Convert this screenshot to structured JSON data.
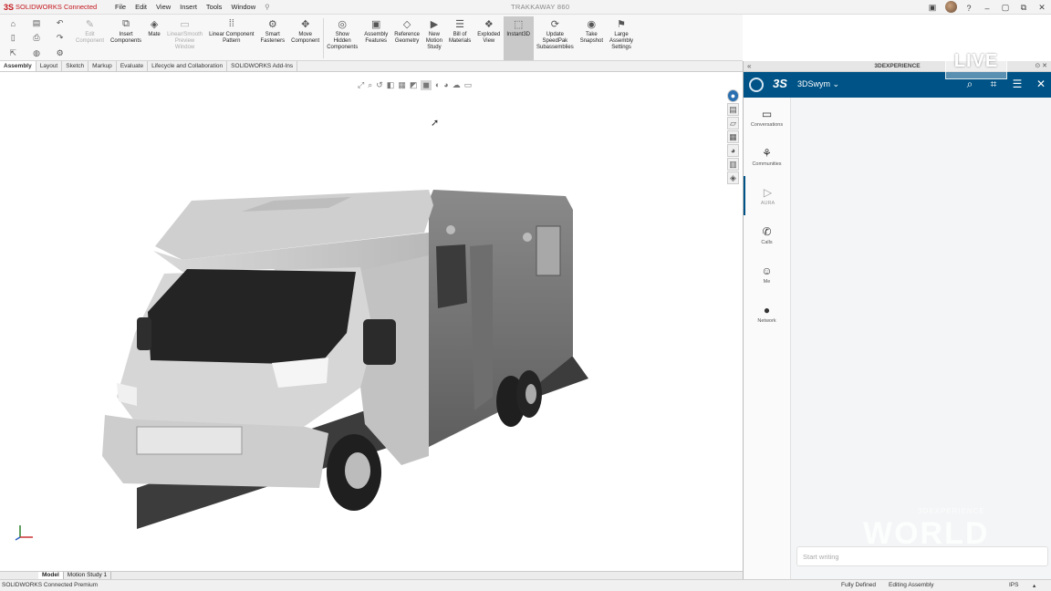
{
  "titlebar": {
    "brand": "SOLIDWORKS Connected",
    "menu": [
      "File",
      "Edit",
      "View",
      "Insert",
      "Tools",
      "Window"
    ],
    "document_title": "TRAKKAWAY 860"
  },
  "ribbon": {
    "tools": [
      {
        "label": "Edit\nComponent",
        "icon": "edit-component-icon",
        "glyph": "✎",
        "disabled": true
      },
      {
        "label": "Insert\nComponents",
        "icon": "insert-components-icon",
        "glyph": "⧉",
        "disabled": false
      },
      {
        "label": "Mate",
        "icon": "mate-icon",
        "glyph": "◈",
        "disabled": false
      },
      {
        "label": "Linear/Smooth\nPreview\nWindow",
        "icon": "preview-window-icon",
        "glyph": "▭",
        "disabled": true
      },
      {
        "label": "Linear Component\nPattern",
        "icon": "linear-pattern-icon",
        "glyph": "⁞⁞",
        "disabled": false
      },
      {
        "label": "Smart\nFasteners",
        "icon": "smart-fasteners-icon",
        "glyph": "⚙",
        "disabled": false
      },
      {
        "label": "Move\nComponent",
        "icon": "move-component-icon",
        "glyph": "✥",
        "disabled": false
      },
      {
        "label": "Show\nHidden\nComponents",
        "icon": "show-hidden-icon",
        "glyph": "◎",
        "disabled": false
      },
      {
        "label": "Assembly\nFeatures",
        "icon": "assembly-features-icon",
        "glyph": "▣",
        "disabled": false
      },
      {
        "label": "Reference\nGeometry",
        "icon": "reference-geometry-icon",
        "glyph": "◇",
        "disabled": false
      },
      {
        "label": "New\nMotion\nStudy",
        "icon": "motion-study-icon",
        "glyph": "▶",
        "disabled": false
      },
      {
        "label": "Bill of\nMaterials",
        "icon": "bill-of-materials-icon",
        "glyph": "☰",
        "disabled": false
      },
      {
        "label": "Exploded\nView",
        "icon": "exploded-view-icon",
        "glyph": "❖",
        "disabled": false
      },
      {
        "label": "Instant3D",
        "icon": "instant3d-icon",
        "glyph": "⬚",
        "disabled": false,
        "active": true
      },
      {
        "label": "Update\nSpeedPak\nSubassemblies",
        "icon": "speedpak-icon",
        "glyph": "⟳",
        "disabled": false
      },
      {
        "label": "Take\nSnapshot",
        "icon": "snapshot-icon",
        "glyph": "◉",
        "disabled": false
      },
      {
        "label": "Large\nAssembly\nSettings",
        "icon": "large-assembly-icon",
        "glyph": "⚑",
        "disabled": false
      }
    ]
  },
  "command_tabs": [
    "Assembly",
    "Layout",
    "Sketch",
    "Markup",
    "Evaluate",
    "Lifecycle and Collaboration",
    "SOLIDWORKS Add-Ins"
  ],
  "bottom_tabs": [
    "Model",
    "Motion Study 1"
  ],
  "status": {
    "left": "SOLIDWORKS Connected Premium",
    "defined": "Fully Defined",
    "mode": "Editing Assembly",
    "units": "IPS"
  },
  "panel": {
    "title": "3DEXPERIENCE",
    "workspace": "3DSwym",
    "nav": [
      {
        "label": "Conversations",
        "icon": "conversations-icon",
        "glyph": "▭"
      },
      {
        "label": "Communities",
        "icon": "communities-icon",
        "glyph": "⚘"
      },
      {
        "label": "AURA",
        "icon": "aura-icon",
        "glyph": "▷",
        "active": true
      },
      {
        "label": "Calls",
        "icon": "phone-icon",
        "glyph": "✆"
      },
      {
        "label": "Me",
        "icon": "person-icon",
        "glyph": "☺"
      },
      {
        "label": "Network",
        "icon": "network-icon",
        "glyph": "●"
      }
    ],
    "compose_placeholder": "Start writing"
  },
  "overlay": {
    "live": "LIVE",
    "watermark": "WORLD",
    "watermark_sub": "3DEXPERIENCE"
  }
}
